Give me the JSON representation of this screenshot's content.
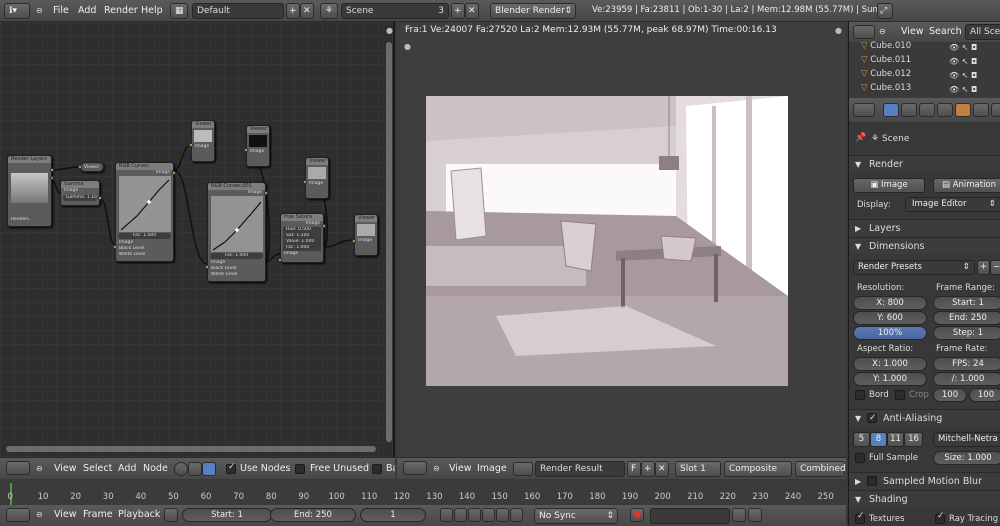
{
  "top_header": {
    "menus": [
      "File",
      "Add",
      "Render",
      "Help"
    ],
    "layout_value": "Default",
    "scene_value": "Scene",
    "scene_users": "3",
    "engine_value": "Blender Render",
    "stats": "Ve:23959 | Fa:23811 | Ob:1-30 | La:2 | Mem:12.98M (55.77M) | Sun"
  },
  "node_editor": {
    "nodes": {
      "render_layers": "Render Layers",
      "render_layers_label": "RenderL",
      "viewer_label": "Viewer",
      "gamma": "Gamma",
      "gamma_value": "Gamma: 1.100",
      "rgb_curves": "RGB Curves",
      "rgb_curves_001": "RGB Curves.001",
      "hue_sat": "Hue Satura",
      "image_label": "Image",
      "fac_label": "Fac: 1.000",
      "black_level": "Black Level",
      "white_level": "White Level",
      "hue_value": "Hue: 0.500",
      "sat_value": "Sat: 1.100",
      "val_value": "Value: 1.000",
      "fac_hs": "Fac: 1.000"
    },
    "header": {
      "menus": [
        "View",
        "Select",
        "Add",
        "Node"
      ],
      "use_nodes_label": "Use Nodes",
      "free_unused_label": "Free Unused",
      "backdrop_label": "Ba"
    }
  },
  "render_view": {
    "info": "Fra:1  Ve:24007 Fa:27520 La:2 Mem:12.93M (55.77M, peak 68.97M) Time:00:16.13",
    "header": {
      "menus": [
        "View",
        "Image"
      ],
      "image_value": "Render Result",
      "fake_user": "F",
      "slot_value": "Slot 1",
      "pass_value": "Composite",
      "combined_label": "Combined"
    }
  },
  "outliner": {
    "header_menus": [
      "View",
      "Search"
    ],
    "scenes_value": "All Scene",
    "items": [
      "Cube.010",
      "Cube.011",
      "Cube.012",
      "Cube.013"
    ]
  },
  "properties": {
    "scene_label": "Scene",
    "render_panel": "Render",
    "render_button": "Image",
    "animation_button": "Animation",
    "display_label": "Display:",
    "display_value": "Image Editor",
    "layers_panel": "Layers",
    "dimensions_panel": "Dimensions",
    "render_presets": "Render Presets",
    "resolution_label": "Resolution:",
    "res_x": "X: 800",
    "res_y": "Y: 600",
    "res_pct": "100%",
    "frame_range_label": "Frame Range:",
    "start": "Start: 1",
    "end": "End: 250",
    "step": "Step: 1",
    "aspect_label": "Aspect Ratio:",
    "aspect_x": "X: 1.000",
    "aspect_y": "Y: 1.000",
    "frame_rate_label": "Frame Rate:",
    "fps": "FPS: 24",
    "fps_base": "/: 1.000",
    "bord_label": "Bord",
    "crop_label": "Crop",
    "time_old": "100",
    "time_new": "100",
    "aa_panel": "Anti-Aliasing",
    "aa_samples": [
      "5",
      "8",
      "11",
      "16"
    ],
    "aa_filter": "Mitchell-Netra",
    "full_sample": "Full Sample",
    "size_value": "Size: 1.000",
    "motion_blur_panel": "Sampled Motion Blur",
    "shading_panel": "Shading",
    "textures_label": "Textures",
    "raytracing_label": "Ray Tracing"
  },
  "timeline": {
    "ticks": [
      "0",
      "10",
      "20",
      "30",
      "40",
      "50",
      "60",
      "70",
      "80",
      "90",
      "100",
      "110",
      "120",
      "130",
      "140",
      "150",
      "160",
      "170",
      "180",
      "190",
      "200",
      "210",
      "220",
      "230",
      "240",
      "250"
    ],
    "menus": [
      "View",
      "Frame",
      "Playback"
    ],
    "start": "Start: 1",
    "end": "End: 250",
    "current": "1",
    "sync": "No Sync"
  }
}
